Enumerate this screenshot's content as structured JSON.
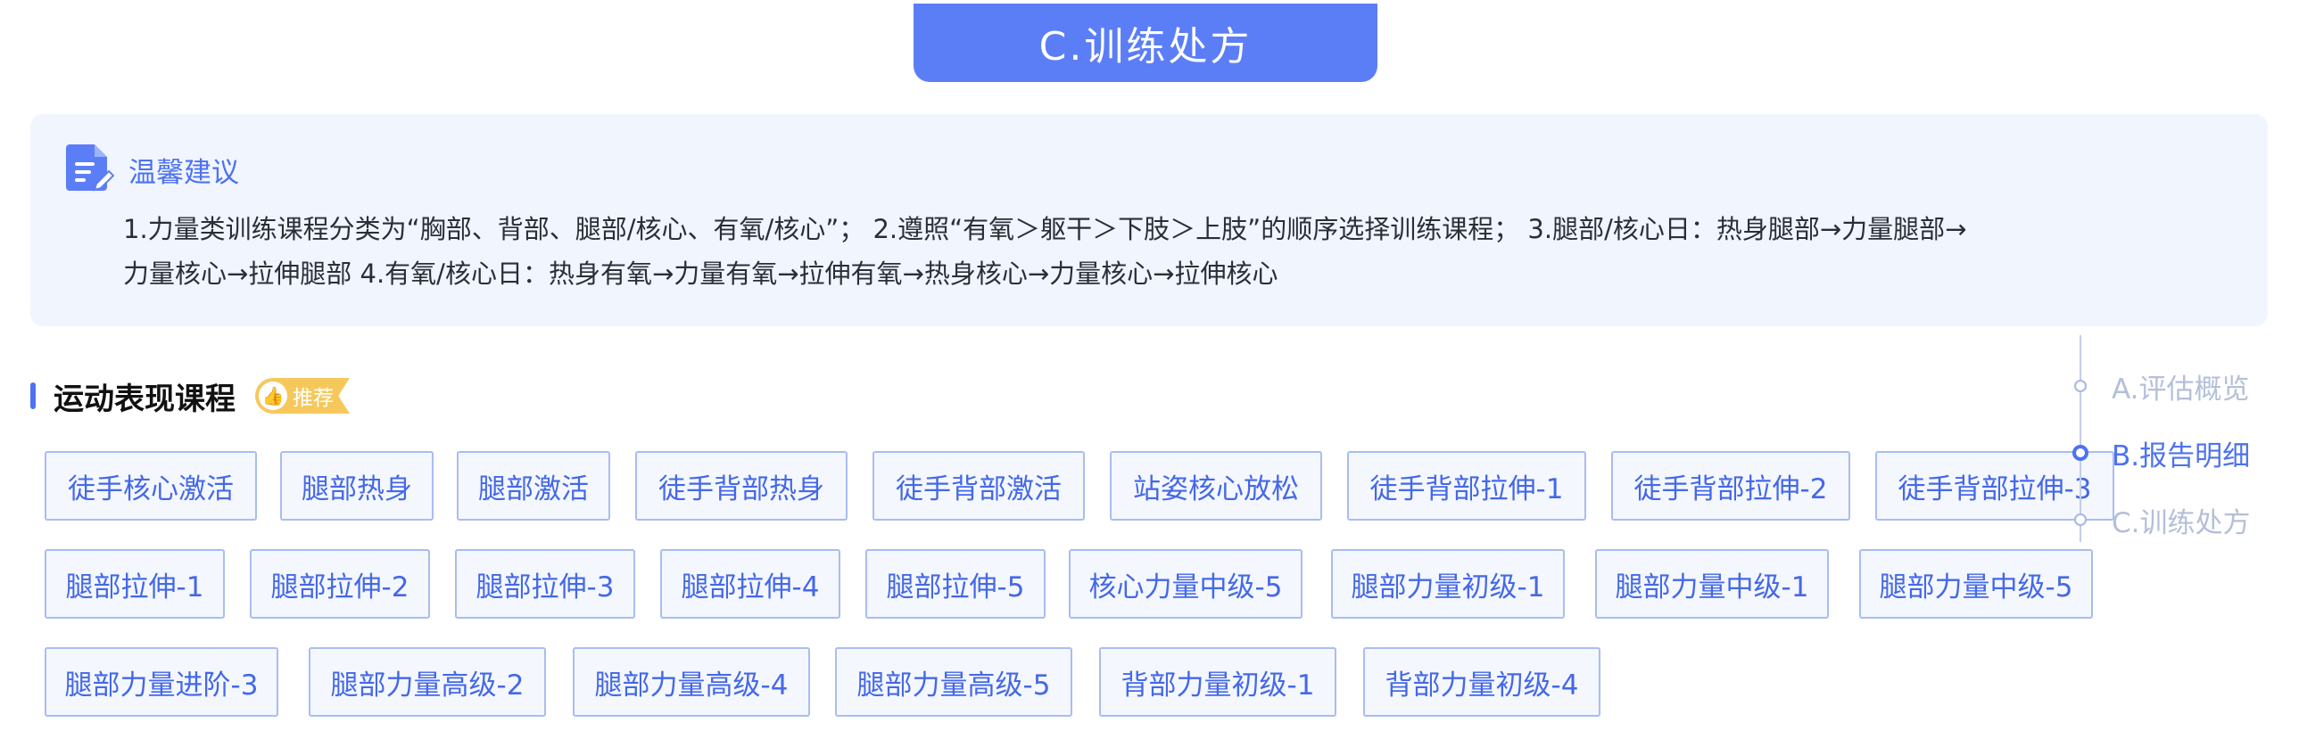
{
  "section_title": "C.训练处方",
  "tips": {
    "title": "温馨建议",
    "line1": "1.力量类训练课程分类为“胸部、背部、腿部/核心、有氧/核心”； 2.遵照“有氧＞躯干＞下肢＞上肢”的顺序选择训练课程； 3.腿部/核心日：热身腿部→力量腿部→",
    "line2": "力量核心→拉伸腿部 4.有氧/核心日：热身有氧→力量有氧→拉伸有氧→热身核心→力量核心→拉伸核心"
  },
  "courses": {
    "title": "运动表现课程",
    "badge": "推荐",
    "tags": [
      "徒手核心激活",
      "腿部热身",
      "腿部激活",
      "徒手背部热身",
      "徒手背部激活",
      "站姿核心放松",
      "徒手背部拉伸-1",
      "徒手背部拉伸-2",
      "徒手背部拉伸-3",
      "腿部拉伸-1",
      "腿部拉伸-2",
      "腿部拉伸-3",
      "腿部拉伸-4",
      "腿部拉伸-5",
      "核心力量中级-5",
      "腿部力量初级-1",
      "腿部力量中级-1",
      "腿部力量中级-5",
      "腿部力量进阶-3",
      "腿部力量高级-2",
      "腿部力量高级-4",
      "腿部力量高级-5",
      "背部力量初级-1",
      "背部力量初级-4"
    ]
  },
  "side_nav": {
    "items": [
      {
        "label": "A.评估概览"
      },
      {
        "label": "B.报告明细"
      },
      {
        "label": "C.训练处方"
      }
    ],
    "active_index": 1
  },
  "colors": {
    "accent": "#4d72f0",
    "tag_bg": "#f4f7fe",
    "tips_bg": "#f1f5fe",
    "badge": "#f6c85c"
  }
}
